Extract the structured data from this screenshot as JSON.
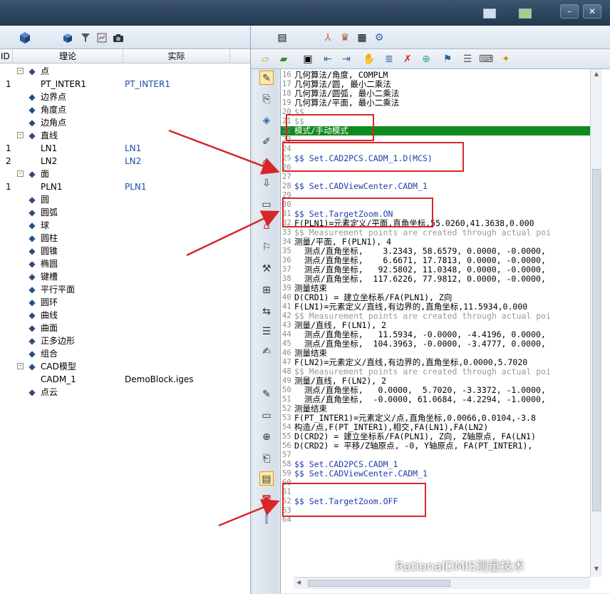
{
  "window": {
    "title_icons": [
      "window-icon",
      "network-icon"
    ],
    "minimize": "–",
    "close": "✕"
  },
  "left": {
    "columns": {
      "id": "ID",
      "nominal": "理论",
      "actual": "实际"
    },
    "tree": [
      {
        "id": "",
        "label": "点",
        "actual": "",
        "level": 0,
        "expander": "–",
        "icon": "point-icon"
      },
      {
        "id": "1",
        "label": "PT_INTER1",
        "actual": "PT_INTER1",
        "level": 1,
        "expander": "",
        "icon": ""
      },
      {
        "id": "",
        "label": "边界点",
        "actual": "",
        "level": 0,
        "expander": "",
        "icon": "edge-point-icon"
      },
      {
        "id": "",
        "label": "角度点",
        "actual": "",
        "level": 0,
        "expander": "",
        "icon": "angle-point-icon"
      },
      {
        "id": "",
        "label": "边角点",
        "actual": "",
        "level": 0,
        "expander": "",
        "icon": "corner-point-icon"
      },
      {
        "id": "",
        "label": "直线",
        "actual": "",
        "level": 0,
        "expander": "–",
        "icon": "line-icon"
      },
      {
        "id": "1",
        "label": "LN1",
        "actual": "LN1",
        "level": 1,
        "expander": "",
        "icon": ""
      },
      {
        "id": "2",
        "label": "LN2",
        "actual": "LN2",
        "level": 1,
        "expander": "",
        "icon": ""
      },
      {
        "id": "",
        "label": "面",
        "actual": "",
        "level": 0,
        "expander": "–",
        "icon": "plane-icon"
      },
      {
        "id": "1",
        "label": "PLN1",
        "actual": "PLN1",
        "level": 1,
        "expander": "",
        "icon": ""
      },
      {
        "id": "",
        "label": "圆",
        "actual": "",
        "level": 0,
        "expander": "",
        "icon": "circle-icon"
      },
      {
        "id": "",
        "label": "圆弧",
        "actual": "",
        "level": 0,
        "expander": "",
        "icon": "arc-icon"
      },
      {
        "id": "",
        "label": "球",
        "actual": "",
        "level": 0,
        "expander": "",
        "icon": "sphere-icon"
      },
      {
        "id": "",
        "label": "圆柱",
        "actual": "",
        "level": 0,
        "expander": "",
        "icon": "cylinder-icon"
      },
      {
        "id": "",
        "label": "圆锥",
        "actual": "",
        "level": 0,
        "expander": "",
        "icon": "cone-icon"
      },
      {
        "id": "",
        "label": "椭圆",
        "actual": "",
        "level": 0,
        "expander": "",
        "icon": "ellipse-icon"
      },
      {
        "id": "",
        "label": "键槽",
        "actual": "",
        "level": 0,
        "expander": "",
        "icon": "slot-icon"
      },
      {
        "id": "",
        "label": "平行平面",
        "actual": "",
        "level": 0,
        "expander": "",
        "icon": "parallel-planes-icon"
      },
      {
        "id": "",
        "label": "圆环",
        "actual": "",
        "level": 0,
        "expander": "",
        "icon": "torus-icon"
      },
      {
        "id": "",
        "label": "曲线",
        "actual": "",
        "level": 0,
        "expander": "",
        "icon": "curve-icon"
      },
      {
        "id": "",
        "label": "曲面",
        "actual": "",
        "level": 0,
        "expander": "",
        "icon": "surface-icon"
      },
      {
        "id": "",
        "label": "正多边形",
        "actual": "",
        "level": 0,
        "expander": "",
        "icon": "polygon-icon"
      },
      {
        "id": "",
        "label": "组合",
        "actual": "",
        "level": 0,
        "expander": "",
        "icon": "group-icon"
      },
      {
        "id": "",
        "label": "CAD模型",
        "actual": "",
        "level": 0,
        "expander": "–",
        "icon": "cad-icon"
      },
      {
        "id": "",
        "label": "CADM_1",
        "actual": "DemoBlock.iges",
        "level": 1,
        "expander": "",
        "icon": ""
      },
      {
        "id": "",
        "label": "点云",
        "actual": "",
        "level": 0,
        "expander": "",
        "icon": "point-cloud-icon"
      }
    ]
  },
  "editor": {
    "lines": [
      {
        "n": "16",
        "t": "几何算法/角度, COMPLM",
        "c": "black"
      },
      {
        "n": "17",
        "t": "几何算法/圆, 最小二乘法",
        "c": "black"
      },
      {
        "n": "18",
        "t": "几何算法/圆弧, 最小二乘法",
        "c": "black"
      },
      {
        "n": "19",
        "t": "几何算法/平面, 最小二乘法",
        "c": "black"
      },
      {
        "n": "20",
        "t": "$$",
        "c": "gray"
      },
      {
        "n": "21",
        "t": "$$",
        "c": "gray"
      },
      {
        "n": "22",
        "t": "模式/手动模式",
        "c": "hl"
      },
      {
        "n": "23",
        "t": "",
        "c": "black"
      },
      {
        "n": "24",
        "t": "",
        "c": "black"
      },
      {
        "n": "25",
        "t": "$$ Set.CAD2PCS.CADM_1.D(MCS)",
        "c": "blue"
      },
      {
        "n": "26",
        "t": "",
        "c": "black"
      },
      {
        "n": "27",
        "t": "",
        "c": "black"
      },
      {
        "n": "28",
        "t": "$$ Set.CADViewCenter.CADM_1",
        "c": "blue"
      },
      {
        "n": "29",
        "t": "",
        "c": "black"
      },
      {
        "n": "30",
        "t": "",
        "c": "black"
      },
      {
        "n": "31",
        "t": "$$ Set.TargetZoom.ON",
        "c": "blue"
      },
      {
        "n": "32",
        "t": "F(PLN1)=元素定义/平面,直角坐标,55.0260,41.3638,0.000",
        "c": "black"
      },
      {
        "n": "33",
        "t": "$$ Measurement points are created through actual poi",
        "c": "gray"
      },
      {
        "n": "34",
        "t": "测量/平面, F(PLN1), 4",
        "c": "black"
      },
      {
        "n": "35",
        "t": "  测点/直角坐标,    3.2343, 58.6579, 0.0000, -0.0000,",
        "c": "black"
      },
      {
        "n": "36",
        "t": "  测点/直角坐标,    6.6671, 17.7813, 0.0000, -0.0000,",
        "c": "black"
      },
      {
        "n": "37",
        "t": "  测点/直角坐标,   92.5802, 11.0348, 0.0000, -0.0000,",
        "c": "black"
      },
      {
        "n": "38",
        "t": "  测点/直角坐标,  117.6226, 77.9812, 0.0000, -0.0000,",
        "c": "black"
      },
      {
        "n": "39",
        "t": "测量结束",
        "c": "black"
      },
      {
        "n": "40",
        "t": "D(CRD1) = 建立坐标系/FA(PLN1), Z向",
        "c": "black"
      },
      {
        "n": "41",
        "t": "F(LN1)=元素定义/直线,有边界的,直角坐标,11.5934,0.000",
        "c": "black"
      },
      {
        "n": "42",
        "t": "$$ Measurement points are created through actual poi",
        "c": "gray"
      },
      {
        "n": "43",
        "t": "测量/直线, F(LN1), 2",
        "c": "black"
      },
      {
        "n": "44",
        "t": "  测点/直角坐标,   11.5934, -0.0000, -4.4196, 0.0000,",
        "c": "black"
      },
      {
        "n": "45",
        "t": "  测点/直角坐标,  104.3963, -0.0000, -3.4777, 0.0000,",
        "c": "black"
      },
      {
        "n": "46",
        "t": "测量结束",
        "c": "black"
      },
      {
        "n": "47",
        "t": "F(LN2)=元素定义/直线,有边界的,直角坐标,0.0000,5.7020",
        "c": "black"
      },
      {
        "n": "48",
        "t": "$$ Measurement points are created through actual poi",
        "c": "gray"
      },
      {
        "n": "49",
        "t": "测量/直线, F(LN2), 2",
        "c": "black"
      },
      {
        "n": "50",
        "t": "  测点/直角坐标,   0.0000,  5.7020, -3.3372, -1.0000,",
        "c": "black"
      },
      {
        "n": "51",
        "t": "  测点/直角坐标,  -0.0000, 61.0684, -4.2294, -1.0000,",
        "c": "black"
      },
      {
        "n": "52",
        "t": "测量结束",
        "c": "black"
      },
      {
        "n": "53",
        "t": "F(PT_INTER1)=元素定义/点,直角坐标,0.0066,0.0104,-3.8",
        "c": "black"
      },
      {
        "n": "54",
        "t": "构造/点,F(PT_INTER1),相交,FA(LN1),FA(LN2)",
        "c": "black"
      },
      {
        "n": "55",
        "t": "D(CRD2) = 建立坐标系/FA(PLN1), Z向, Z轴原点, FA(LN1)",
        "c": "black"
      },
      {
        "n": "56",
        "t": "D(CRD2) = 平移/Z轴原点, -0, Y轴原点, FA(PT_INTER1),",
        "c": "black"
      },
      {
        "n": "57",
        "t": "",
        "c": "black"
      },
      {
        "n": "58",
        "t": "$$ Set.CAD2PCS.CADM_1",
        "c": "blue"
      },
      {
        "n": "59",
        "t": "$$ Set.CADViewCenter.CADM_1",
        "c": "blue"
      },
      {
        "n": "60",
        "t": "",
        "c": "black"
      },
      {
        "n": "61",
        "t": "",
        "c": "black"
      },
      {
        "n": "62",
        "t": "$$ Set.TargetZoom.OFF",
        "c": "blue"
      },
      {
        "n": "63",
        "t": "",
        "c": "black"
      },
      {
        "n": "64",
        "t": "",
        "c": "black"
      }
    ]
  },
  "watermark": "RationalDMIS测量技术",
  "colors": {
    "highlight": "#0f8a1e",
    "annotation": "#d8262a",
    "code_blue": "#1c3fa8"
  }
}
